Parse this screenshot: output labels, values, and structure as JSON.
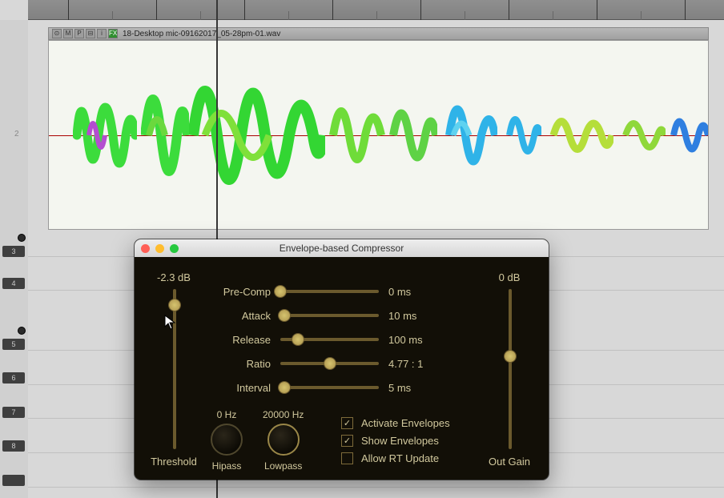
{
  "item": {
    "filename": "18-Desktop mic-09162017_05-28pm-01.wav",
    "header_buttons": [
      "⊙",
      "M",
      "P",
      "⊟",
      "i",
      "FX"
    ]
  },
  "track_numbers": [
    "2",
    "3",
    "4",
    "5",
    "6",
    "7",
    "8"
  ],
  "plugin": {
    "title": "Envelope-based Compressor",
    "threshold": {
      "value_label": "-2.3 dB",
      "caption": "Threshold",
      "pos": 0.1
    },
    "outgain": {
      "value_label": "0 dB",
      "caption": "Out Gain",
      "pos": 0.52
    },
    "sliders": [
      {
        "label": "Pre-Comp",
        "value": "0 ms",
        "pos": 0.0
      },
      {
        "label": "Attack",
        "value": "10 ms",
        "pos": 0.04
      },
      {
        "label": "Release",
        "value": "100 ms",
        "pos": 0.18
      },
      {
        "label": "Ratio",
        "value": "4.77 : 1",
        "pos": 0.5
      },
      {
        "label": "Interval",
        "value": "5 ms",
        "pos": 0.04
      }
    ],
    "hipass": {
      "label": "Hipass",
      "value": "0 Hz"
    },
    "lowpass": {
      "label": "Lowpass",
      "value": "20000 Hz"
    },
    "checks": [
      {
        "label": "Activate Envelopes",
        "checked": true
      },
      {
        "label": "Show Envelopes",
        "checked": true
      },
      {
        "label": "Allow RT Update",
        "checked": false
      }
    ]
  }
}
